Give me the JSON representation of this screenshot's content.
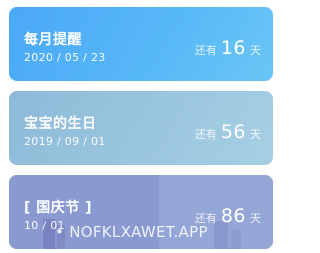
{
  "cards": [
    {
      "title": "每月提醒",
      "date": "2020 / 05 / 23",
      "prefix": "还有",
      "days": "16",
      "suffix": "天",
      "color": "#4aa8f7"
    },
    {
      "title": "宝宝的生日",
      "date": "2019 / 09 / 01",
      "prefix": "还有",
      "days": "56",
      "suffix": "天",
      "color": "#8dbad8"
    },
    {
      "title": "[ 国庆节 ]",
      "date": "10 / 01",
      "prefix": "还有",
      "days": "86",
      "suffix": "天",
      "color": "#7f8fc9"
    }
  ],
  "watermark": "• NOFKLXAWET.APP"
}
